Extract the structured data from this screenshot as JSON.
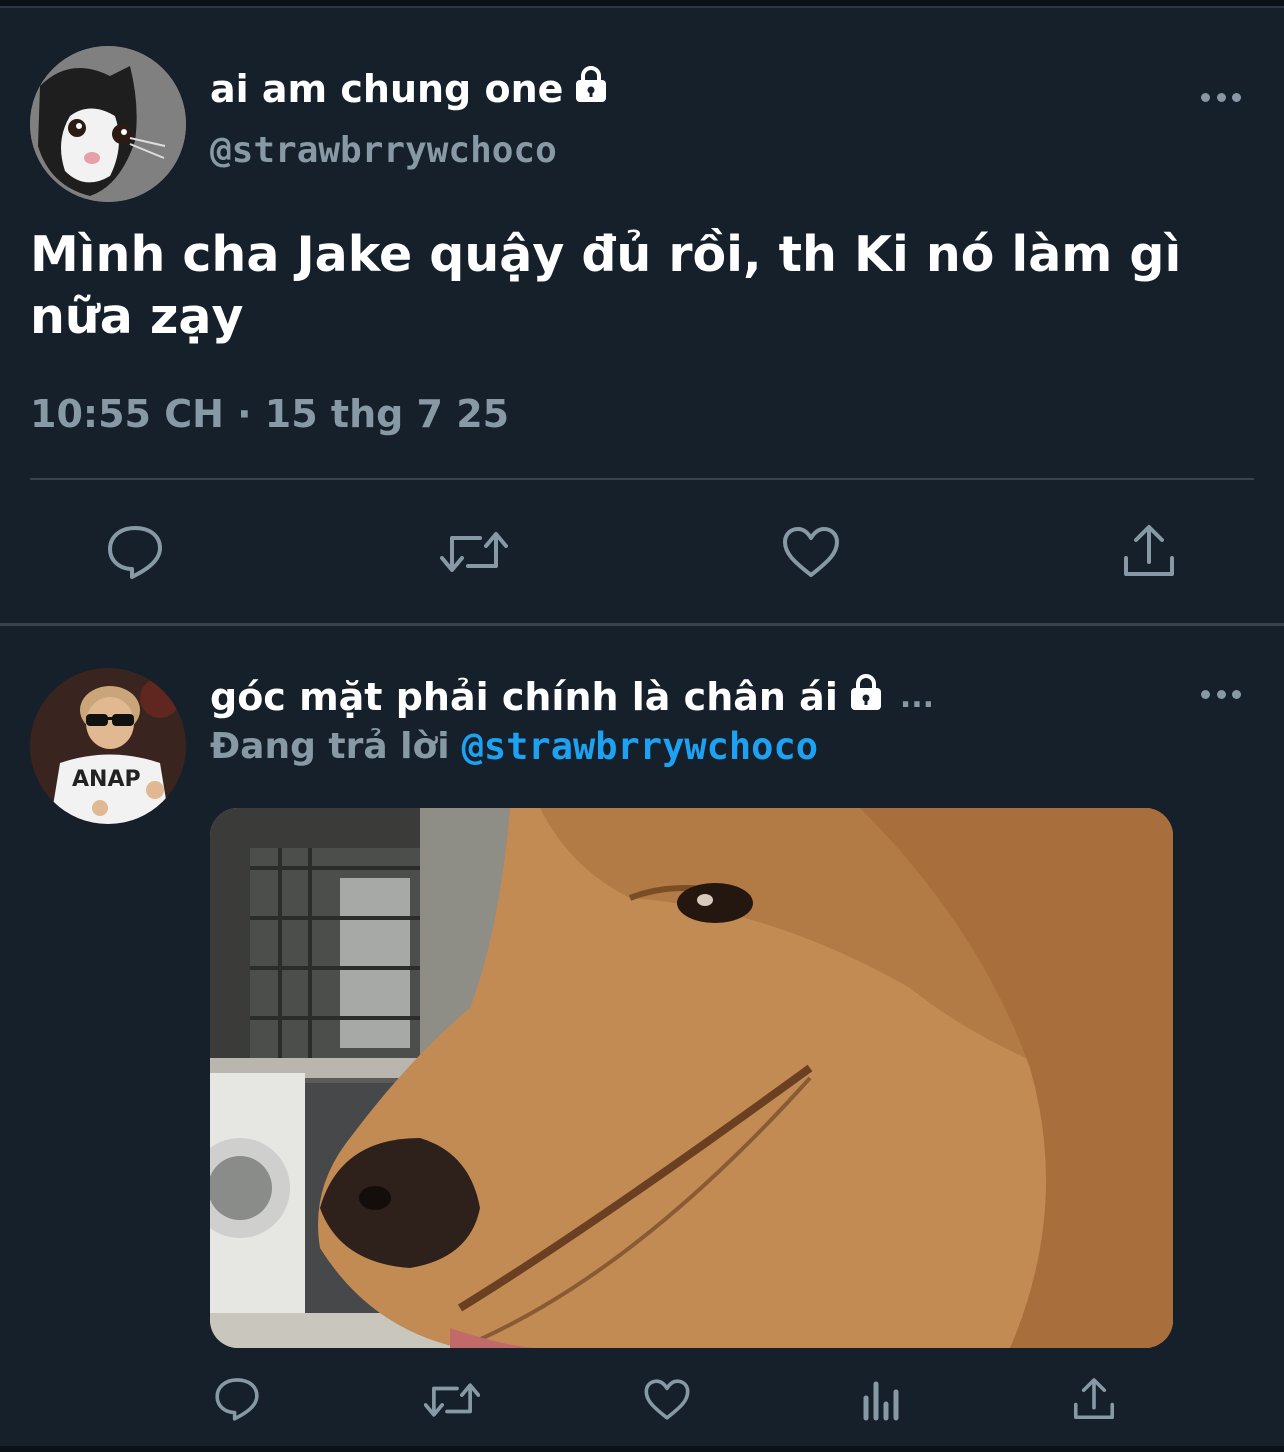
{
  "colors": {
    "background": "#15202b",
    "secondary_text": "#8899a6",
    "link": "#1da1f2",
    "divider": "#38444d"
  },
  "main_tweet": {
    "display_name": "ai am chung one",
    "protected_icon": "lock-icon",
    "handle": "@strawbrrywchoco",
    "text": "Mình cha Jake quậy đủ rồi, th Ki nó làm gì nữa zạy",
    "time": "10:55 CH",
    "separator": "·",
    "date": "15 thg 7 25",
    "menu_icon": "more-icon",
    "actions": [
      "reply-icon",
      "retweet-icon",
      "like-icon",
      "share-icon"
    ]
  },
  "reply_tweet": {
    "display_name": "góc mặt phải chính là chân ái",
    "protected_icon": "lock-icon",
    "truncation": "...",
    "replying_label": "Đang trả lời",
    "replying_to": "@strawbrrywchoco",
    "media_icon": "photo-golden-retriever",
    "menu_icon": "more-icon",
    "actions": [
      "reply-icon",
      "retweet-icon",
      "like-icon",
      "analytics-icon",
      "share-icon"
    ]
  }
}
